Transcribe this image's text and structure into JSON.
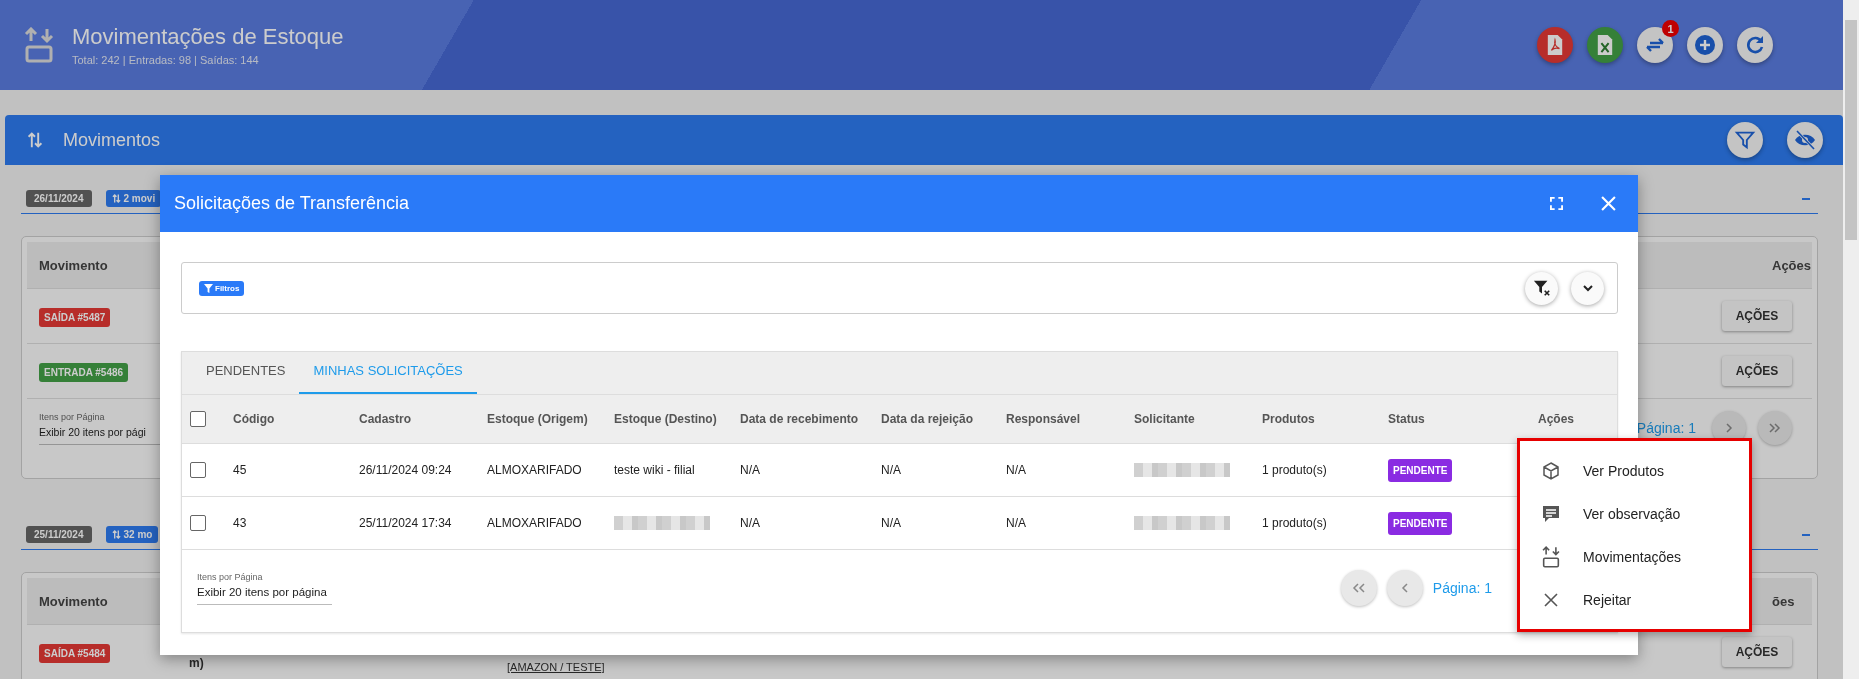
{
  "header": {
    "title": "Movimentações de Estoque",
    "subtitle": "Total: 242 | Entradas: 98 | Saídas: 144",
    "actions": [
      {
        "kind": "pdf"
      },
      {
        "kind": "excel"
      },
      {
        "kind": "transfer",
        "badge": "1"
      },
      {
        "kind": "add"
      },
      {
        "kind": "refresh"
      }
    ]
  },
  "section": {
    "title": "Movimentos"
  },
  "groups": [
    {
      "date": "26/11/2024",
      "count": "2 movi",
      "columns": [
        "Movimento",
        "Ações"
      ],
      "rows": [
        {
          "label": "SAÍDA #5487",
          "kind": "saida",
          "action": "AÇÕES"
        },
        {
          "label": "ENTRADA #5486",
          "kind": "entrada",
          "action": "AÇÕES"
        }
      ],
      "per_page_label": "Itens por Página",
      "per_page_value": "Exibir 20 itens por pági",
      "page": "Página: 1"
    },
    {
      "date": "25/11/2024",
      "count": "32 mo",
      "columns": [
        "Movimento",
        "ões"
      ],
      "rows": [
        {
          "label": "SAÍDA #5484",
          "kind": "saida",
          "note": "m)",
          "link": "[AMAZON / TESTE]",
          "action": "AÇÕES"
        }
      ]
    }
  ],
  "modal": {
    "title": "Solicitações de Transferência",
    "filter_chip": "Filtros",
    "tabs": [
      {
        "label": "PENDENTES",
        "selected": false
      },
      {
        "label": "MINHAS SOLICITAÇÕES",
        "selected": true
      }
    ],
    "all_checked": false,
    "columns": [
      "Código",
      "Cadastro",
      "Estoque (Origem)",
      "Estoque (Destino)",
      "Data de recebimento",
      "Data da rejeição",
      "Responsável",
      "Solicitante",
      "Produtos",
      "Status",
      "Ações"
    ],
    "rows": [
      {
        "checked": false,
        "codigo": "45",
        "cadastro": "26/11/2024 09:24",
        "origem": "ALMOXARIFADO",
        "destino": "teste wiki - filial",
        "destino_redacted": false,
        "recebimento": "N/A",
        "rejeicao": "N/A",
        "responsavel": "N/A",
        "solicitante_redacted": true,
        "produtos": "1 produto(s)",
        "status": "PENDENTE"
      },
      {
        "checked": false,
        "codigo": "43",
        "cadastro": "25/11/2024 17:34",
        "origem": "ALMOXARIFADO",
        "destino_redacted": true,
        "recebimento": "N/A",
        "rejeicao": "N/A",
        "responsavel": "N/A",
        "solicitante_redacted": true,
        "produtos": "1 produto(s)",
        "status": "PENDENTE"
      }
    ],
    "per_page_label": "Itens por Página",
    "per_page_value": "Exibir 20 itens por página",
    "page": "Página: 1"
  },
  "menu": [
    {
      "kind": "box",
      "label": "Ver Produtos"
    },
    {
      "kind": "note",
      "label": "Ver observação"
    },
    {
      "kind": "moves",
      "label": "Movimentações"
    },
    {
      "kind": "close",
      "label": "Rejeitar"
    }
  ]
}
